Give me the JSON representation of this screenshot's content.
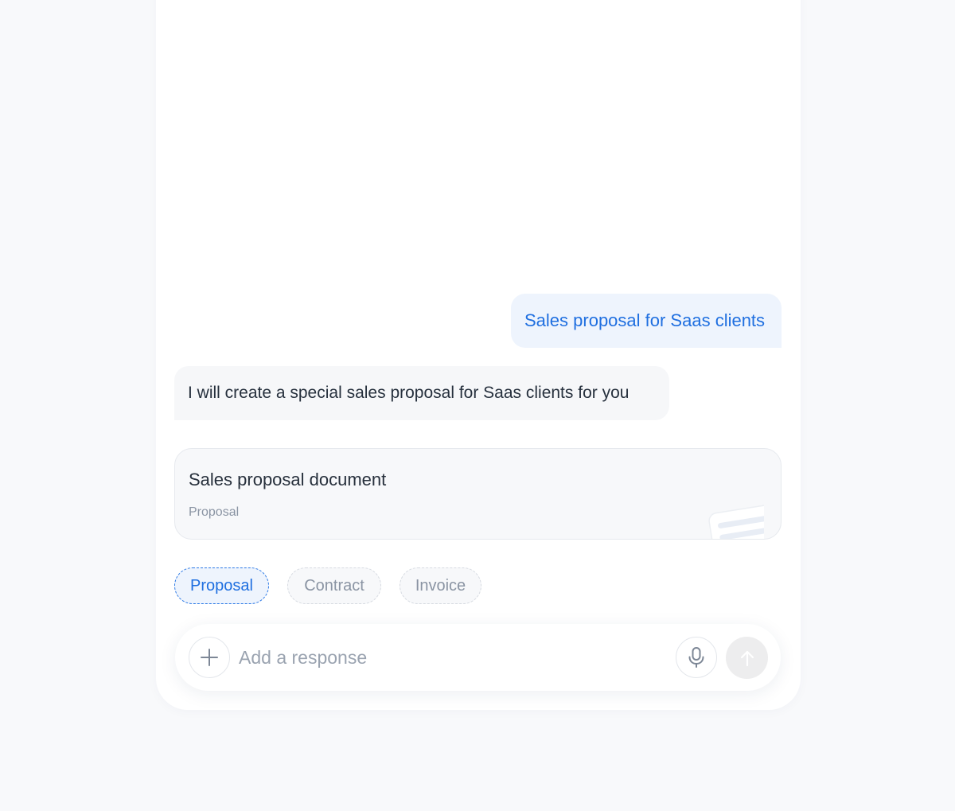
{
  "conversation": {
    "user_message": "Sales proposal for Saas clients",
    "assistant_message": "I will create a special sales proposal for Saas clients for you"
  },
  "document_card": {
    "title": "Sales proposal document",
    "type": "Proposal",
    "illustration_icon": "document-stack-icon"
  },
  "chips": [
    {
      "label": "Proposal",
      "selected": true
    },
    {
      "label": "Contract",
      "selected": false
    },
    {
      "label": "Invoice",
      "selected": false
    }
  ],
  "composer": {
    "placeholder": "Add a response",
    "value": "",
    "add_icon": "plus-icon",
    "mic_icon": "microphone-icon",
    "send_icon": "arrow-up-icon"
  },
  "colors": {
    "accent": "#1f6fe0",
    "user_bubble_bg": "#eef4fd",
    "assistant_bubble_bg": "#f6f7f9",
    "page_bg": "#f8f9fb",
    "muted_text": "#8a94a3"
  }
}
